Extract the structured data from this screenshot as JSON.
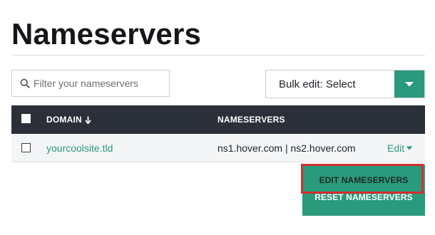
{
  "page": {
    "title": "Nameservers"
  },
  "search": {
    "placeholder": "Filter your nameservers",
    "icon": "search-icon"
  },
  "bulk_edit": {
    "label": "Bulk edit: Select",
    "toggle_icon": "caret-down-icon"
  },
  "table": {
    "columns": {
      "domain": "DOMAIN",
      "domain_sort_icon": "sort-down-arrow-icon",
      "nameservers": "NAMESERVERS"
    },
    "rows": [
      {
        "domain": "yourcoolsite.tld",
        "nameservers": "ns1.hover.com | ns2.hover.com",
        "edit_label": "Edit"
      }
    ]
  },
  "dropdown": {
    "items": [
      {
        "label": "EDIT NAMESERVERS",
        "highlighted": true
      },
      {
        "label": "RESET NAMESERVERS",
        "highlighted": false
      }
    ]
  },
  "colors": {
    "accent": "#2a9a7c",
    "header_bg": "#2b3038",
    "highlight": "#d32f2f"
  }
}
